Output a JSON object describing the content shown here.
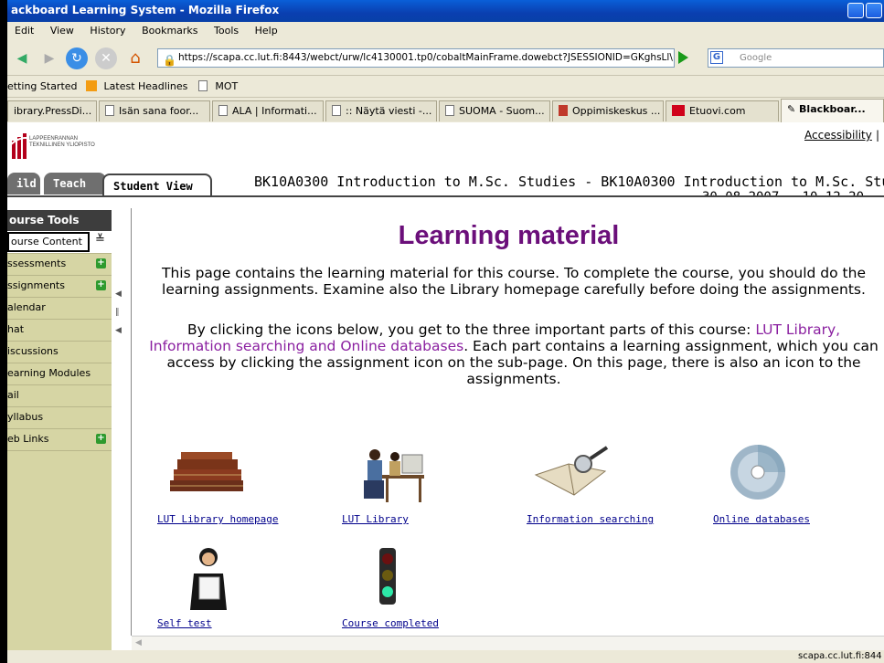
{
  "window": {
    "title": "ackboard Learning System - Mozilla Firefox"
  },
  "menu": [
    "Edit",
    "View",
    "History",
    "Bookmarks",
    "Tools",
    "Help"
  ],
  "nav": {
    "url": "https://scapa.cc.lut.fi:8443/webct/urw/lc4130001.tp0/cobaltMainFrame.dowebct?JSESSIONID=GKghsLl\\",
    "search_placeholder": "Google",
    "search_engine": "G"
  },
  "bookmarks": [
    "etting Started",
    "Latest Headlines",
    "MOT"
  ],
  "tabs": [
    "ibrary.PressDi...",
    "Isän sana foor...",
    "ALA | Informati...",
    ":: Näytä viesti -...",
    "SUOMA - Suom...",
    "Oppimiskeskus ...",
    "Etuovi.com",
    "Blackboar..."
  ],
  "header": {
    "uni_line1": "LAPPEENRANNAN",
    "uni_line2": "TEKNILLINEN YLIOPISTO",
    "accessibility": "Accessibility",
    "accessibility_sep": "|",
    "tab_build": "ild",
    "tab_teach": "Teach",
    "tab_student": "Student View",
    "course_title": "BK10A0300 Introduction to M.Sc. Studies - BK10A0300 Introduction to M.Sc. Studi",
    "course_date": "30.08.2007 - 10.12.20"
  },
  "sidebar": {
    "heading": "ourse Tools",
    "current": "ourse Content",
    "items": [
      {
        "label": "ssessments",
        "plus": true
      },
      {
        "label": "ssignments",
        "plus": true
      },
      {
        "label": "alendar",
        "plus": false
      },
      {
        "label": "hat",
        "plus": false
      },
      {
        "label": "iscussions",
        "plus": false
      },
      {
        "label": "earning Modules",
        "plus": false
      },
      {
        "label": "ail",
        "plus": false
      },
      {
        "label": "yllabus",
        "plus": false
      },
      {
        "label": "eb Links",
        "plus": true
      }
    ]
  },
  "main": {
    "title": "Learning material",
    "para1": "This page contains the learning material for this course. To complete the course, you should do the learning assignments. Examine also the Library homepage carefully before doing the assignments.",
    "para2_start": "By clicking the icons below, you get to the three important parts of this course: ",
    "para2_highlight": "LUT Library, Information searching and Online databases",
    "para2_end": ". Each part contains a learning assignment, which you can access by clicking the assignment icon on the sub-page. On this page, there is also an icon to the assignments.",
    "resources": [
      "LUT Library homepage",
      "LUT Library",
      "Information searching",
      "Online databases",
      "Self test",
      "Course completed"
    ]
  },
  "status": {
    "text": "scapa.cc.lut.fi:844"
  },
  "colors": {
    "title_purple": "#6b0f7a",
    "sidebar_bg": "#d6d5a4",
    "link_blue": "#00008b"
  }
}
